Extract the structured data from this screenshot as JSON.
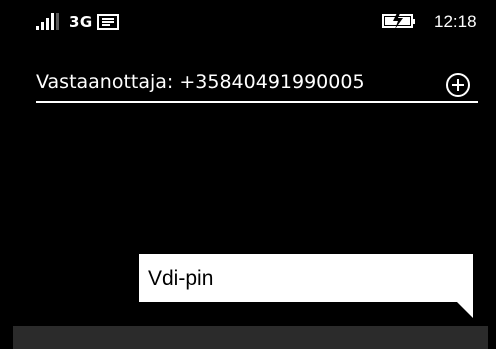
{
  "status_bar": {
    "network": "3G",
    "time": "12:18",
    "icons": [
      "signal-strength-icon",
      "message-icon",
      "battery-charging-icon"
    ]
  },
  "recipient": {
    "text": "Vastaanottaja:  +35840491990005",
    "add_icon": "plus-circle-icon"
  },
  "message": {
    "text": "Vdi-pin"
  },
  "colors": {
    "background": "#000000",
    "foreground": "#ffffff",
    "bubble": "#ffffff",
    "bottom_bar": "#2b2b2b"
  }
}
